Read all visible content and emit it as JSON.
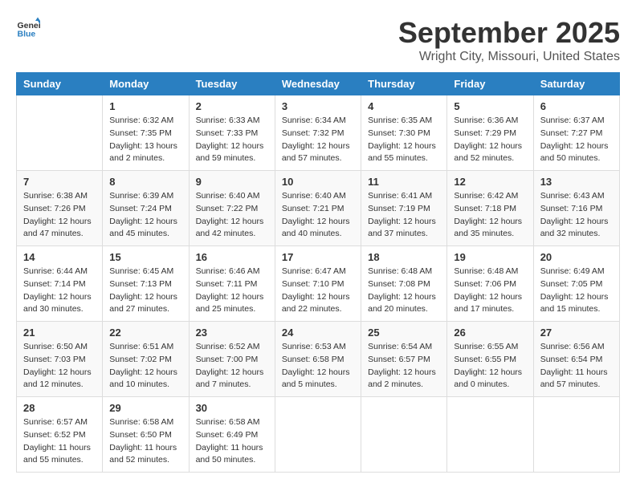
{
  "header": {
    "logo_general": "General",
    "logo_blue": "Blue",
    "month": "September 2025",
    "location": "Wright City, Missouri, United States"
  },
  "days_of_week": [
    "Sunday",
    "Monday",
    "Tuesday",
    "Wednesday",
    "Thursday",
    "Friday",
    "Saturday"
  ],
  "weeks": [
    [
      {
        "day": "",
        "info": ""
      },
      {
        "day": "1",
        "info": "Sunrise: 6:32 AM\nSunset: 7:35 PM\nDaylight: 13 hours\nand 2 minutes."
      },
      {
        "day": "2",
        "info": "Sunrise: 6:33 AM\nSunset: 7:33 PM\nDaylight: 12 hours\nand 59 minutes."
      },
      {
        "day": "3",
        "info": "Sunrise: 6:34 AM\nSunset: 7:32 PM\nDaylight: 12 hours\nand 57 minutes."
      },
      {
        "day": "4",
        "info": "Sunrise: 6:35 AM\nSunset: 7:30 PM\nDaylight: 12 hours\nand 55 minutes."
      },
      {
        "day": "5",
        "info": "Sunrise: 6:36 AM\nSunset: 7:29 PM\nDaylight: 12 hours\nand 52 minutes."
      },
      {
        "day": "6",
        "info": "Sunrise: 6:37 AM\nSunset: 7:27 PM\nDaylight: 12 hours\nand 50 minutes."
      }
    ],
    [
      {
        "day": "7",
        "info": "Sunrise: 6:38 AM\nSunset: 7:26 PM\nDaylight: 12 hours\nand 47 minutes."
      },
      {
        "day": "8",
        "info": "Sunrise: 6:39 AM\nSunset: 7:24 PM\nDaylight: 12 hours\nand 45 minutes."
      },
      {
        "day": "9",
        "info": "Sunrise: 6:40 AM\nSunset: 7:22 PM\nDaylight: 12 hours\nand 42 minutes."
      },
      {
        "day": "10",
        "info": "Sunrise: 6:40 AM\nSunset: 7:21 PM\nDaylight: 12 hours\nand 40 minutes."
      },
      {
        "day": "11",
        "info": "Sunrise: 6:41 AM\nSunset: 7:19 PM\nDaylight: 12 hours\nand 37 minutes."
      },
      {
        "day": "12",
        "info": "Sunrise: 6:42 AM\nSunset: 7:18 PM\nDaylight: 12 hours\nand 35 minutes."
      },
      {
        "day": "13",
        "info": "Sunrise: 6:43 AM\nSunset: 7:16 PM\nDaylight: 12 hours\nand 32 minutes."
      }
    ],
    [
      {
        "day": "14",
        "info": "Sunrise: 6:44 AM\nSunset: 7:14 PM\nDaylight: 12 hours\nand 30 minutes."
      },
      {
        "day": "15",
        "info": "Sunrise: 6:45 AM\nSunset: 7:13 PM\nDaylight: 12 hours\nand 27 minutes."
      },
      {
        "day": "16",
        "info": "Sunrise: 6:46 AM\nSunset: 7:11 PM\nDaylight: 12 hours\nand 25 minutes."
      },
      {
        "day": "17",
        "info": "Sunrise: 6:47 AM\nSunset: 7:10 PM\nDaylight: 12 hours\nand 22 minutes."
      },
      {
        "day": "18",
        "info": "Sunrise: 6:48 AM\nSunset: 7:08 PM\nDaylight: 12 hours\nand 20 minutes."
      },
      {
        "day": "19",
        "info": "Sunrise: 6:48 AM\nSunset: 7:06 PM\nDaylight: 12 hours\nand 17 minutes."
      },
      {
        "day": "20",
        "info": "Sunrise: 6:49 AM\nSunset: 7:05 PM\nDaylight: 12 hours\nand 15 minutes."
      }
    ],
    [
      {
        "day": "21",
        "info": "Sunrise: 6:50 AM\nSunset: 7:03 PM\nDaylight: 12 hours\nand 12 minutes."
      },
      {
        "day": "22",
        "info": "Sunrise: 6:51 AM\nSunset: 7:02 PM\nDaylight: 12 hours\nand 10 minutes."
      },
      {
        "day": "23",
        "info": "Sunrise: 6:52 AM\nSunset: 7:00 PM\nDaylight: 12 hours\nand 7 minutes."
      },
      {
        "day": "24",
        "info": "Sunrise: 6:53 AM\nSunset: 6:58 PM\nDaylight: 12 hours\nand 5 minutes."
      },
      {
        "day": "25",
        "info": "Sunrise: 6:54 AM\nSunset: 6:57 PM\nDaylight: 12 hours\nand 2 minutes."
      },
      {
        "day": "26",
        "info": "Sunrise: 6:55 AM\nSunset: 6:55 PM\nDaylight: 12 hours\nand 0 minutes."
      },
      {
        "day": "27",
        "info": "Sunrise: 6:56 AM\nSunset: 6:54 PM\nDaylight: 11 hours\nand 57 minutes."
      }
    ],
    [
      {
        "day": "28",
        "info": "Sunrise: 6:57 AM\nSunset: 6:52 PM\nDaylight: 11 hours\nand 55 minutes."
      },
      {
        "day": "29",
        "info": "Sunrise: 6:58 AM\nSunset: 6:50 PM\nDaylight: 11 hours\nand 52 minutes."
      },
      {
        "day": "30",
        "info": "Sunrise: 6:58 AM\nSunset: 6:49 PM\nDaylight: 11 hours\nand 50 minutes."
      },
      {
        "day": "",
        "info": ""
      },
      {
        "day": "",
        "info": ""
      },
      {
        "day": "",
        "info": ""
      },
      {
        "day": "",
        "info": ""
      }
    ]
  ]
}
